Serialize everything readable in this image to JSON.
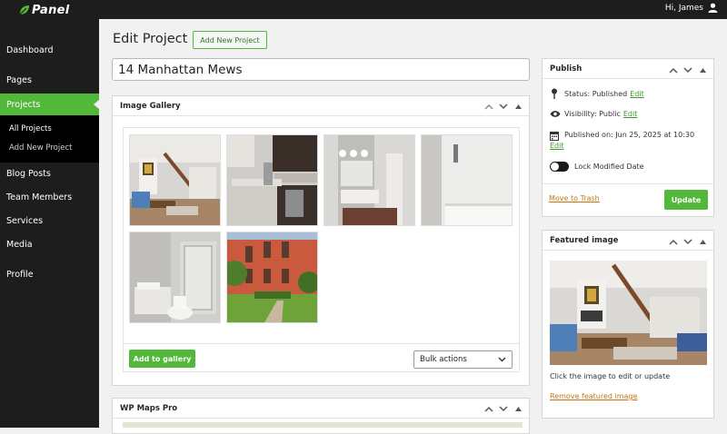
{
  "header": {
    "logo_text": "Panel",
    "greeting": "Hi, James"
  },
  "sidebar": {
    "items": [
      {
        "label": "Dashboard"
      },
      {
        "label": "Pages"
      },
      {
        "label": "Projects"
      },
      {
        "label": "Blog Posts"
      },
      {
        "label": "Team Members"
      },
      {
        "label": "Services"
      },
      {
        "label": "Media"
      },
      {
        "label": "Profile"
      }
    ],
    "projects_submenu": [
      {
        "label": "All Projects"
      },
      {
        "label": "Add New Project"
      }
    ]
  },
  "main": {
    "page_title": "Edit Project",
    "add_new_label": "Add New Project",
    "post_title": "14 Manhattan Mews",
    "gallery": {
      "title": "Image Gallery",
      "images": [
        {
          "name": "living-room"
        },
        {
          "name": "kitchen"
        },
        {
          "name": "bathroom-vanity"
        },
        {
          "name": "bathtub"
        },
        {
          "name": "bathroom-shower"
        },
        {
          "name": "exterior"
        }
      ],
      "add_button": "Add to gallery",
      "bulk_actions": "Bulk actions"
    },
    "maps": {
      "title": "WP Maps Pro"
    }
  },
  "publish": {
    "title": "Publish",
    "status_label": "Status: Published",
    "visibility_label": "Visibility: Public",
    "published_on_label": "Published on: Jun 25, 2025 at 10:30",
    "edit_label": "Edit",
    "lock_label": "Lock Modified Date",
    "trash_label": "Move to Trash",
    "update_label": "Update"
  },
  "featured": {
    "title": "Featured image",
    "hint": "Click the image to edit or update",
    "remove_label": "Remove featured image"
  },
  "colors": {
    "accent": "#52b83a",
    "sidebar_bg": "#1d1d1d",
    "link_orange": "#c77412"
  }
}
